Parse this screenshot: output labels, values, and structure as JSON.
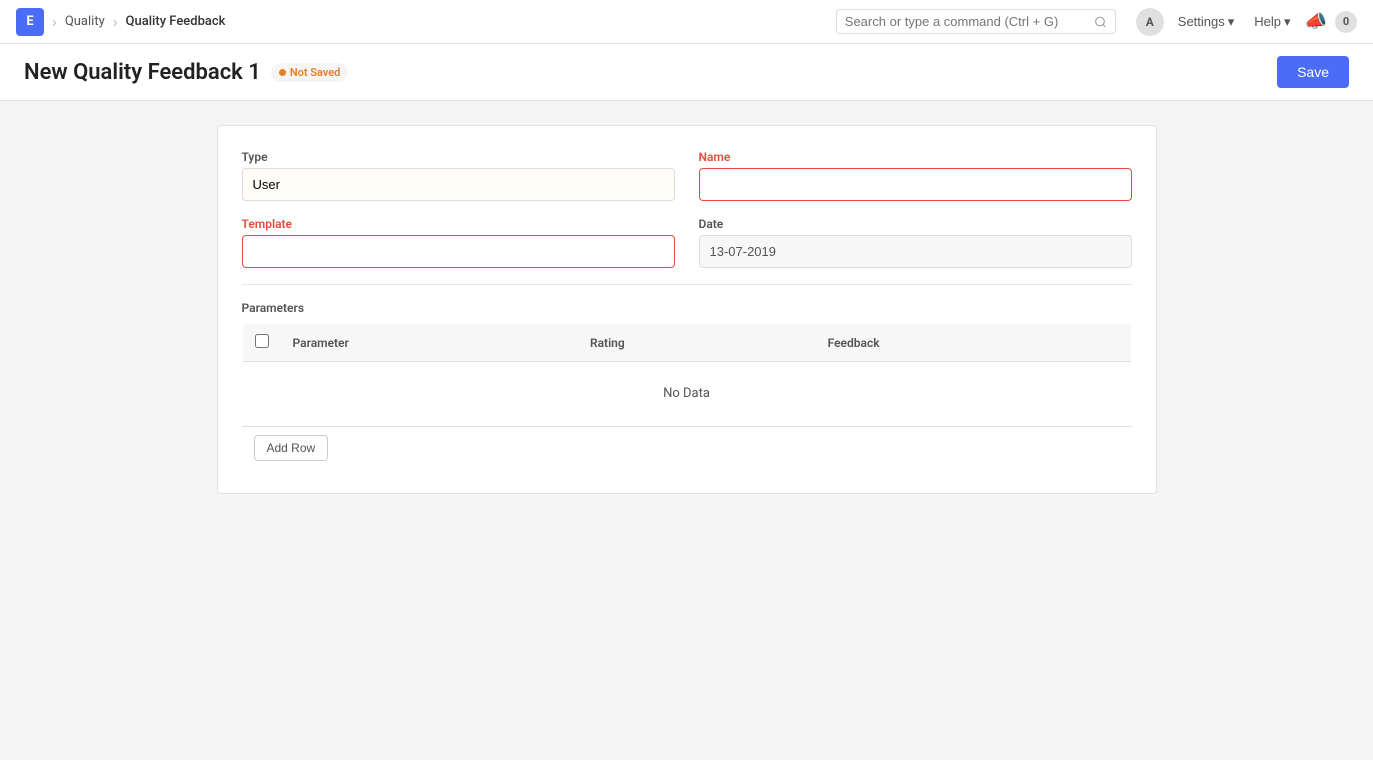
{
  "navbar": {
    "brand": "E",
    "breadcrumb": [
      {
        "label": "Quality",
        "active": false
      },
      {
        "label": "Quality Feedback",
        "active": true
      }
    ],
    "search_placeholder": "Search or type a command (Ctrl + G)",
    "settings_label": "Settings",
    "help_label": "Help",
    "avatar_label": "A",
    "notification_count": "0"
  },
  "page": {
    "title": "New Quality Feedback 1",
    "status": "Not Saved",
    "save_label": "Save"
  },
  "form": {
    "type_label": "Type",
    "type_value": "User",
    "name_label": "Name",
    "name_value": "",
    "template_label": "Template",
    "template_value": "",
    "date_label": "Date",
    "date_value": "13-07-2019",
    "parameters_label": "Parameters",
    "table": {
      "columns": [
        {
          "key": "parameter",
          "label": "Parameter"
        },
        {
          "key": "rating",
          "label": "Rating"
        },
        {
          "key": "feedback",
          "label": "Feedback"
        }
      ],
      "no_data": "No Data",
      "add_row_label": "Add Row"
    }
  }
}
